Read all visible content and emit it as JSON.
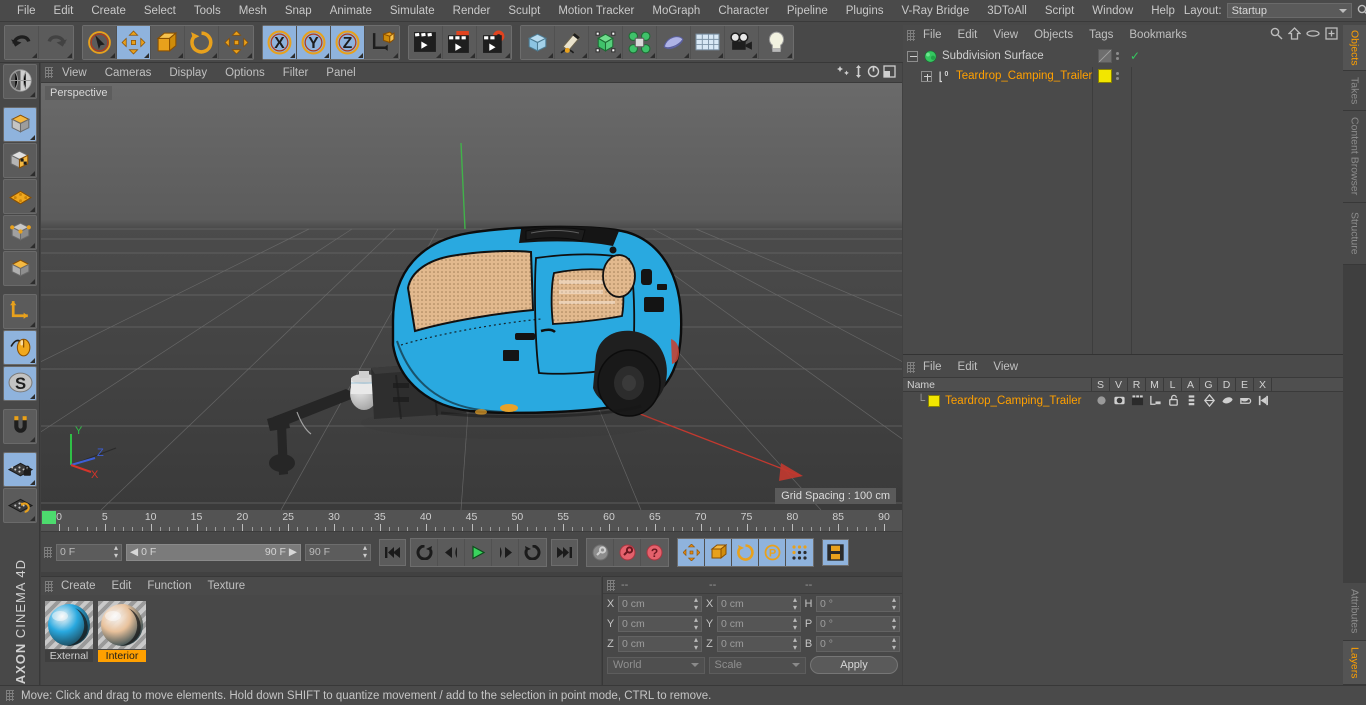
{
  "app": {
    "name": "MAXON",
    "product": "CINEMA 4D"
  },
  "menubar": {
    "items": [
      "File",
      "Edit",
      "Create",
      "Select",
      "Tools",
      "Mesh",
      "Snap",
      "Animate",
      "Simulate",
      "Render",
      "Sculpt",
      "Motion Tracker",
      "MoGraph",
      "Character",
      "Pipeline",
      "Plugins",
      "V-Ray Bridge",
      "3DToAll",
      "Script",
      "Window",
      "Help"
    ],
    "layout_label": "Layout:",
    "layout_value": "Startup",
    "search_icon": "search-icon"
  },
  "toolbar": {
    "groups": [
      {
        "name": "undo-redo",
        "buttons": [
          {
            "icon": "undo-icon",
            "label": "Undo",
            "selected": false
          },
          {
            "icon": "redo-icon",
            "label": "Redo",
            "selected": false
          }
        ]
      },
      {
        "name": "transform-tools",
        "buttons": [
          {
            "icon": "live-selection-icon",
            "label": "Live Selection",
            "selected": false
          },
          {
            "icon": "move-icon",
            "label": "Move",
            "selected": true
          },
          {
            "icon": "scale-icon",
            "label": "Scale",
            "selected": false
          },
          {
            "icon": "rotate-icon",
            "label": "Rotate",
            "selected": false
          },
          {
            "icon": "move-alt-icon",
            "label": "Move Alt",
            "selected": false
          }
        ]
      },
      {
        "name": "axis-locks",
        "buttons": [
          {
            "icon": "x-axis-icon",
            "label": "X",
            "selected": true
          },
          {
            "icon": "y-axis-icon",
            "label": "Y",
            "selected": true
          },
          {
            "icon": "z-axis-icon",
            "label": "Z",
            "selected": true
          },
          {
            "icon": "world-coord-icon",
            "label": "World/Object",
            "selected": false
          }
        ]
      },
      {
        "name": "render-group",
        "buttons": [
          {
            "icon": "render-view-icon",
            "label": "Render View",
            "selected": false
          },
          {
            "icon": "render-picture-viewer-icon",
            "label": "Render to Picture Viewer",
            "selected": false
          },
          {
            "icon": "render-settings-icon",
            "label": "Edit Render Settings",
            "selected": false
          }
        ]
      },
      {
        "name": "create-group",
        "buttons": [
          {
            "icon": "cube-primitive-icon",
            "label": "Add Cube Object",
            "selected": false
          },
          {
            "icon": "spline-pen-icon",
            "label": "Spline Pen",
            "selected": false
          },
          {
            "icon": "nurbs-icon",
            "label": "Subdivision Surface",
            "selected": false
          },
          {
            "icon": "mograph-cloner-icon",
            "label": "MoGraph Cloner",
            "selected": false
          },
          {
            "icon": "deformer-icon",
            "label": "Bend Deformer",
            "selected": false
          },
          {
            "icon": "floor-scene-icon",
            "label": "Floor",
            "selected": false
          },
          {
            "icon": "camera-icon",
            "label": "Camera",
            "selected": false
          },
          {
            "icon": "light-icon",
            "label": "Light",
            "selected": false
          }
        ]
      }
    ]
  },
  "left_toolbar": {
    "buttons": [
      {
        "icon": "make-editable-icon",
        "label": "Make Editable",
        "selected": false
      },
      {
        "icon": "model-mode-icon",
        "label": "Model Mode",
        "selected": true
      },
      {
        "icon": "texture-mode-icon",
        "label": "Texture Mode",
        "selected": false
      },
      {
        "icon": "points-mode-icon",
        "label": "Points Mode",
        "selected": false
      },
      {
        "icon": "edges-mode-icon",
        "label": "Edges Mode",
        "selected": false
      },
      {
        "icon": "polygons-mode-icon",
        "label": "Polygons Mode",
        "selected": false
      },
      {
        "icon": "axis-mode-icon",
        "label": "Enable Axis Modification",
        "selected": false
      },
      {
        "icon": "viewport-solo-icon",
        "label": "Viewport Solo",
        "selected": true
      },
      {
        "icon": "soft-selection-icon",
        "label": "Soft Selection",
        "selected": true
      },
      {
        "icon": "snap-magnet-icon",
        "label": "Enable Snapping",
        "selected": false
      },
      {
        "icon": "workplane-lock-icon",
        "label": "Lock Workplane",
        "selected": true
      },
      {
        "icon": "workplane-rotate-icon",
        "label": "Workplane Rotate",
        "selected": false
      }
    ]
  },
  "viewport": {
    "menu": [
      "View",
      "Cameras",
      "Display",
      "Options",
      "Filter",
      "Panel"
    ],
    "icons": [
      "pan-icon",
      "dolly-icon",
      "orbit-icon",
      "maximize-icon"
    ],
    "label": "Perspective",
    "grid_spacing": "Grid Spacing : 100 cm",
    "axis_gizmo": {
      "y": "Y",
      "z": "Z",
      "x": "X"
    },
    "scene_object": "Teardrop_Camping_Trailer",
    "colors": {
      "body": "#29a9e0",
      "body_dark": "#1f8cbe",
      "interior": "#e2b98e",
      "black_parts": "#2b2b2b",
      "grid": "#6e6e6e",
      "bg_top": "#606060",
      "bg_bottom": "#3f3f3f",
      "x_axis": "#c2392f",
      "y_axis": "#41b24a"
    }
  },
  "timeline": {
    "ticks": [
      "0",
      "5",
      "10",
      "15",
      "20",
      "25",
      "30",
      "35",
      "40",
      "45",
      "50",
      "55",
      "60",
      "65",
      "70",
      "75",
      "80",
      "85",
      "90"
    ],
    "current_frame_field": "0 F",
    "range_start": "0 F",
    "range_end": "90 F",
    "max_frame_field": "90 F",
    "end_frame_field": "0 F",
    "transport": [
      {
        "icon": "goto-start-icon",
        "label": "Go to Start",
        "selected": false
      },
      {
        "icon": "play-back-loop-icon",
        "label": "Play Backwards Loop",
        "selected": false
      },
      {
        "icon": "step-back-icon",
        "label": "Step Back",
        "selected": false
      },
      {
        "icon": "play-icon",
        "label": "Play Forwards",
        "selected": false
      },
      {
        "icon": "step-forward-icon",
        "label": "Step Forward",
        "selected": false
      },
      {
        "icon": "play-forward-loop-icon",
        "label": "Play Forwards Loop",
        "selected": false
      },
      {
        "icon": "goto-end-icon",
        "label": "Go to End",
        "selected": false
      }
    ],
    "keys": [
      {
        "icon": "record-key-icon",
        "label": "Record Active Objects",
        "selected": false
      },
      {
        "icon": "autokey-icon",
        "label": "Autokeying",
        "selected": false
      },
      {
        "icon": "keyframe-selection-icon",
        "label": "Keyframe Selection",
        "selected": false
      }
    ],
    "key_toggles": [
      {
        "icon": "position-key-icon",
        "label": "Position",
        "selected": true
      },
      {
        "icon": "scale-key-icon",
        "label": "Scale",
        "selected": true
      },
      {
        "icon": "rotation-key-icon",
        "label": "Rotation",
        "selected": true
      },
      {
        "icon": "param-key-icon",
        "label": "Parameter",
        "selected": true
      },
      {
        "icon": "pla-key-icon",
        "label": "Point Level Animation",
        "selected": true
      }
    ],
    "last": {
      "icon": "timeline-icon",
      "label": "Animation Mode",
      "selected": true
    }
  },
  "materials": {
    "menu": [
      "Create",
      "Edit",
      "Function",
      "Texture"
    ],
    "items": [
      {
        "name": "External",
        "color": "#29a9e0",
        "selected": false
      },
      {
        "name": "Interior",
        "color": "#e8c19b",
        "selected": true
      }
    ]
  },
  "coordinates": {
    "headers": [
      "--",
      "--",
      "--"
    ],
    "rows": [
      {
        "axis1": "X",
        "val1": "0 cm",
        "axis2": "X",
        "val2": "0 cm",
        "axis3": "H",
        "val3": "0 °"
      },
      {
        "axis1": "Y",
        "val1": "0 cm",
        "axis2": "Y",
        "val2": "0 cm",
        "axis3": "P",
        "val3": "0 °"
      },
      {
        "axis1": "Z",
        "val1": "0 cm",
        "axis2": "Z",
        "val2": "0 cm",
        "axis3": "B",
        "val3": "0 °"
      }
    ],
    "system": "World",
    "mode": "Scale",
    "apply": "Apply"
  },
  "object_manager": {
    "menu": [
      "File",
      "Edit",
      "View",
      "Objects",
      "Tags",
      "Bookmarks"
    ],
    "icons": [
      "search-icon",
      "home-icon",
      "ellipse-icon",
      "add-layer-icon"
    ],
    "objects": [
      {
        "name": "Subdivision Surface",
        "icon": "subdivision-surface-icon",
        "indent": 0,
        "expanded": true,
        "tag_color": "none",
        "check": "✓"
      },
      {
        "name": "Teardrop_Camping_Trailer",
        "icon": "polygon-object-icon",
        "indent": 1,
        "expanded": false,
        "tag_color": "#f2e600",
        "check": ""
      }
    ]
  },
  "layer_manager": {
    "menu": [
      "File",
      "Edit",
      "View"
    ],
    "columns": [
      "Name",
      "S",
      "V",
      "R",
      "M",
      "L",
      "A",
      "G",
      "D",
      "E",
      "X"
    ],
    "rows": [
      {
        "name": "Teardrop_Camping_Trailer",
        "color": "#f2e600"
      }
    ]
  },
  "right_tabs": {
    "top": [
      {
        "label": "Objects",
        "active": true
      },
      {
        "label": "Takes",
        "active": false
      },
      {
        "label": "Content Browser",
        "active": false
      },
      {
        "label": "Structure",
        "active": false
      }
    ],
    "bottom": [
      {
        "label": "Attributes",
        "active": false
      },
      {
        "label": "Layers",
        "active": true
      }
    ]
  },
  "status_bar": {
    "text": "Move: Click and drag to move elements. Hold down SHIFT to quantize movement / add to the selection in point mode, CTRL to remove."
  }
}
